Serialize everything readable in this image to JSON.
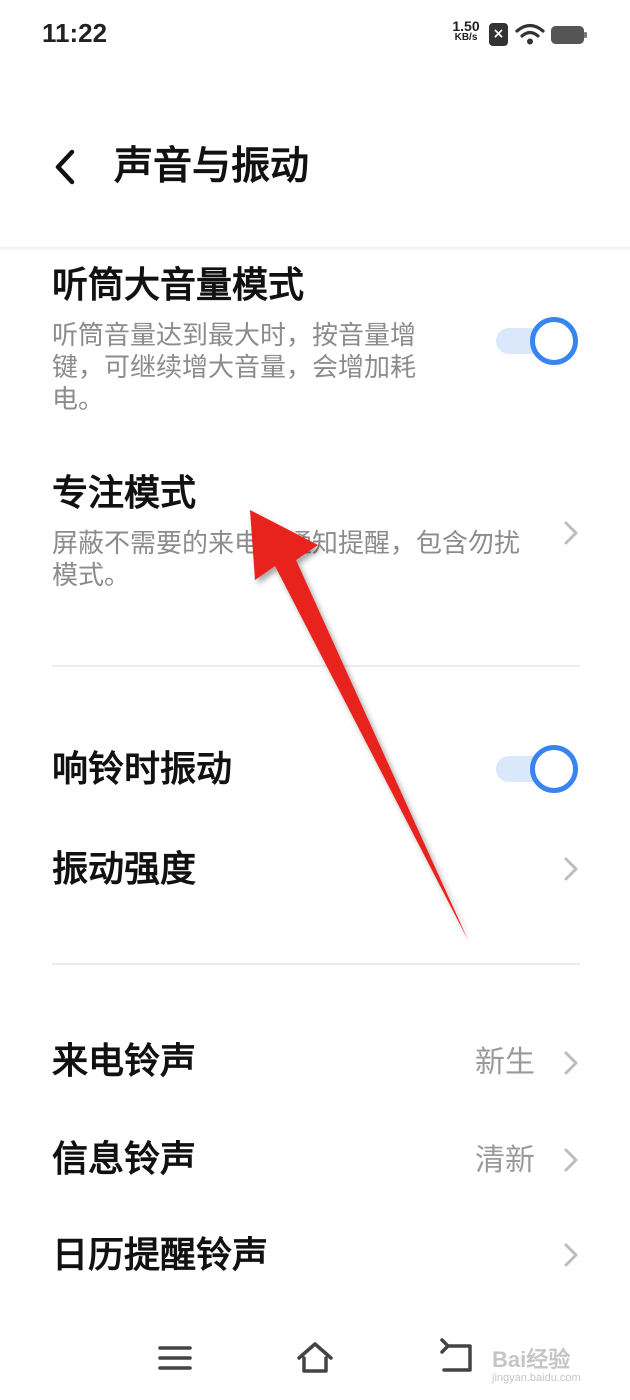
{
  "status_bar": {
    "time": "11:22",
    "net_speed_value": "1.50",
    "net_speed_unit": "KB/s",
    "sim_badge": "×",
    "icons": [
      "wifi-icon",
      "battery-icon"
    ]
  },
  "header": {
    "title": "声音与振动",
    "back_icon": "chevron-left-icon"
  },
  "items": [
    {
      "title": "听筒大音量模式",
      "desc": "听筒音量达到最大时，按音量增键，可继续增大音量，会增加耗电。",
      "control": "toggle",
      "on": true
    },
    {
      "title": "专注模式",
      "desc": "屏蔽不需要的来电和通知提醒，包含勿扰模式。",
      "control": "chevron"
    },
    {
      "title": "响铃时振动",
      "control": "toggle",
      "on": true
    },
    {
      "title": "振动强度",
      "control": "chevron"
    },
    {
      "title": "来电铃声",
      "value": "新生",
      "control": "chevron"
    },
    {
      "title": "信息铃声",
      "value": "清新",
      "control": "chevron"
    },
    {
      "title": "日历提醒铃声",
      "control": "chevron"
    }
  ],
  "nav_bar": {
    "icons": [
      "menu-icon",
      "home-icon",
      "back-icon"
    ]
  },
  "watermark": {
    "text": "Bai经验",
    "sub": "jingyan.baidu.com"
  },
  "colors": {
    "accent": "#3a84f2",
    "toggle_track": "#dbe8fb",
    "annotation_arrow": "#e8201c"
  }
}
